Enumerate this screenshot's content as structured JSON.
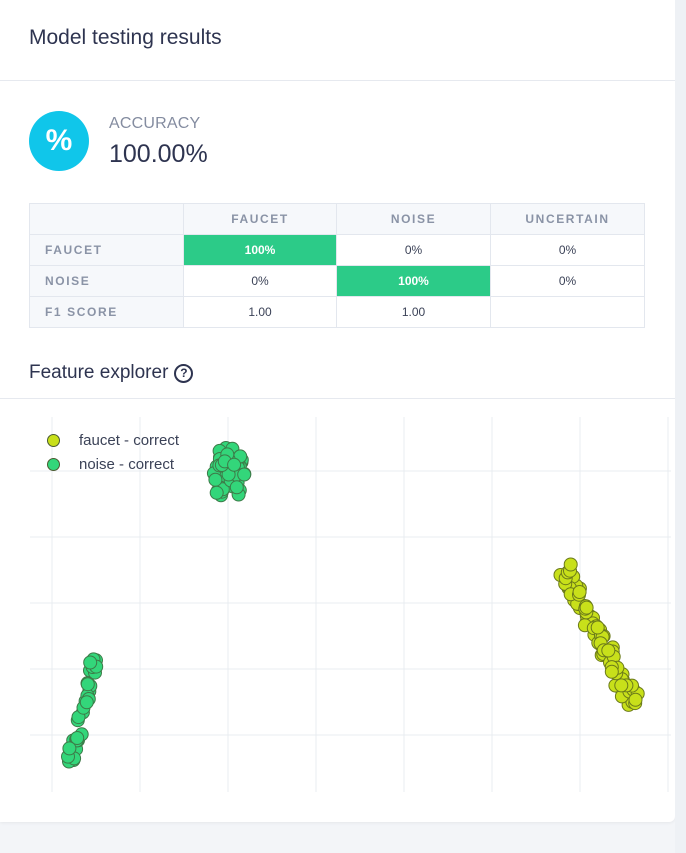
{
  "header": {
    "title": "Model testing results"
  },
  "accuracy": {
    "icon": "percent-icon",
    "icon_glyph": "%",
    "label": "ACCURACY",
    "value": "100.00%",
    "icon_color": "#10c6ea"
  },
  "confusion_matrix": {
    "columns": [
      "FAUCET",
      "NOISE",
      "UNCERTAIN"
    ],
    "rows": [
      {
        "label": "FAUCET",
        "cells": [
          "100%",
          "0%",
          "0%"
        ]
      },
      {
        "label": "NOISE",
        "cells": [
          "0%",
          "100%",
          "0%"
        ]
      },
      {
        "label": "F1 SCORE",
        "cells": [
          "1.00",
          "1.00",
          ""
        ]
      }
    ],
    "highlight_color": "#2ccb88"
  },
  "feature_explorer": {
    "title": "Feature explorer",
    "help_icon": "help-circle-icon",
    "help_glyph": "?",
    "legend": [
      {
        "name": "faucet - correct",
        "color": "#c8e01a"
      },
      {
        "name": "noise - correct",
        "color": "#33d67a"
      }
    ]
  }
}
